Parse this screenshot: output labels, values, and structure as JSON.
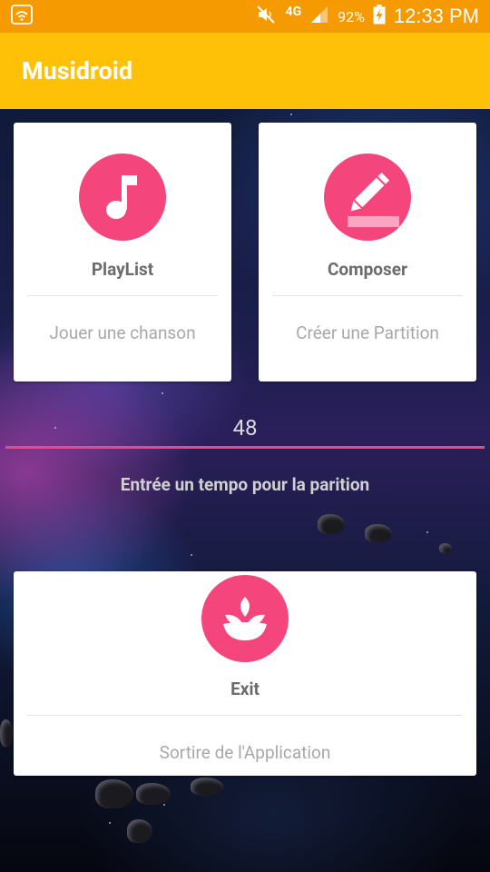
{
  "status_bar": {
    "battery": "92%",
    "time": "12:33 PM",
    "network": "4G",
    "icons": [
      "notification-app-icon",
      "mute-icon",
      "signal-icon",
      "battery-charging-icon"
    ]
  },
  "app_bar": {
    "title": "Musidroid"
  },
  "cards": {
    "playlist": {
      "title": "PlayList",
      "subtitle": "Jouer une chanson",
      "icon": "music-note-icon"
    },
    "composer": {
      "title": "Composer",
      "subtitle": "Créer une Partition",
      "icon": "pencil-icon"
    },
    "exit": {
      "title": "Exit",
      "subtitle": "Sortire de l'Application",
      "icon": "lotus-icon"
    }
  },
  "tempo": {
    "value": "48",
    "hint": "Entrée un tempo pour la parition"
  },
  "colors": {
    "accent": "#F5457D",
    "status_bar": "#F59A00",
    "app_bar": "#FFC107"
  }
}
